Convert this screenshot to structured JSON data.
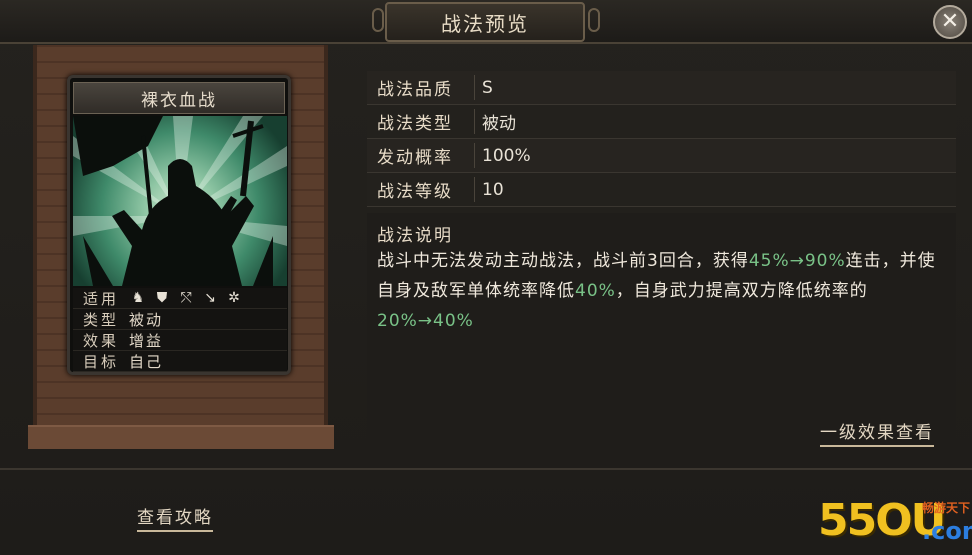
{
  "window": {
    "title": "战法预览",
    "close_label": "✕"
  },
  "card": {
    "name": "裸衣血战",
    "rows": [
      {
        "key": "适用",
        "value": ""
      },
      {
        "key": "类型",
        "value": "被动"
      },
      {
        "key": "效果",
        "value": "增益"
      },
      {
        "key": "目标",
        "value": "自己"
      }
    ],
    "applicable_icons": [
      "cavalry-icon",
      "shield-icon",
      "bow-icon",
      "spear-icon",
      "chariot-icon"
    ]
  },
  "attributes": [
    {
      "key": "战法品质",
      "value": "S"
    },
    {
      "key": "战法类型",
      "value": "被动"
    },
    {
      "key": "发动概率",
      "value": "100%"
    },
    {
      "key": "战法等级",
      "value": "10"
    }
  ],
  "description": {
    "heading": "战法说明",
    "parts": [
      {
        "text": "战斗中无法发动主动战法，战斗前3回合，获得",
        "hl": false
      },
      {
        "text": "45%→90%",
        "hl": true
      },
      {
        "text": "连击，并使自身及敌军单体统率降低",
        "hl": false
      },
      {
        "text": "40%",
        "hl": true
      },
      {
        "text": "，自身武力提高双方降低统率的",
        "hl": false
      },
      {
        "text": "20%→40%",
        "hl": true
      }
    ],
    "highlight_color": "#79c287"
  },
  "links": {
    "effect_view": "一级效果查看",
    "guide": "查看攻略"
  },
  "watermark": {
    "number": "55OU",
    "site_cn": "畅游天下",
    "domain": ".com"
  }
}
